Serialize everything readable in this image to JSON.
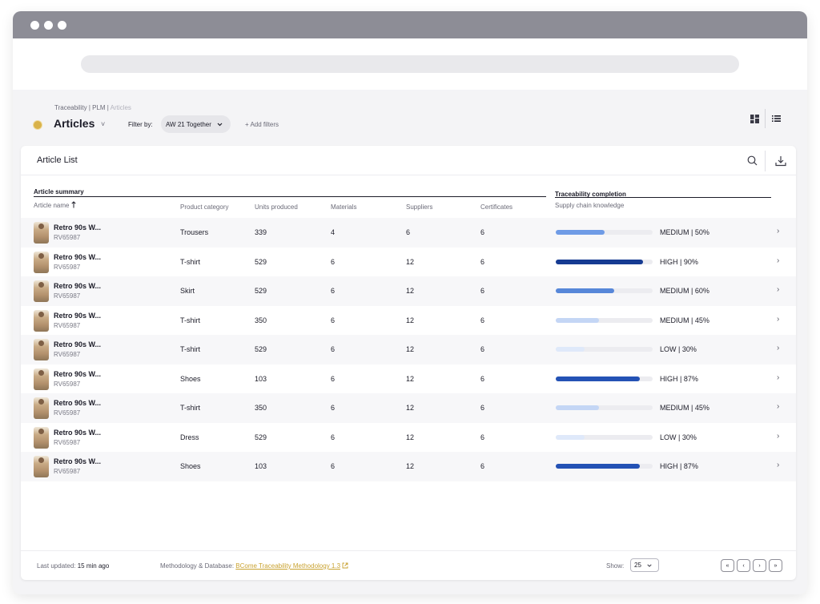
{
  "window": {
    "colors": {
      "titlebar": "#8d8d96",
      "accent": "#d9b24a",
      "link": "#c9a230"
    }
  },
  "header": {
    "breadcrumb": {
      "part1": "Traceability | PLM | ",
      "current": "Articles"
    },
    "title": "Articles",
    "title_chevron": "˅",
    "filter_label": "Filter by:",
    "filter_value": "AW 21 Together",
    "add_filters": "+ Add filters"
  },
  "card": {
    "title": "Article List",
    "groups": {
      "summary": "Article summary",
      "traceability": "Traceability completion"
    },
    "columns": {
      "name": "Article name",
      "category": "Product category",
      "units": "Units produced",
      "materials": "Materials",
      "suppliers": "Suppliers",
      "certificates": "Certificates",
      "knowledge": "Supply chain knowledge"
    },
    "rows": [
      {
        "name": "Retro 90s W...",
        "code": "RV65987",
        "category": "Trousers",
        "units": "339",
        "materials": "4",
        "suppliers": "6",
        "certificates": "6",
        "status": "MEDIUM | 50%",
        "progress": 0.5,
        "color": "#6f9be6"
      },
      {
        "name": "Retro 90s W...",
        "code": "RV65987",
        "category": "T-shirt",
        "units": "529",
        "materials": "6",
        "suppliers": "12",
        "certificates": "6",
        "status": "HIGH | 90%",
        "progress": 0.9,
        "color": "#163b92"
      },
      {
        "name": "Retro 90s W...",
        "code": "RV65987",
        "category": "Skirt",
        "units": "529",
        "materials": "6",
        "suppliers": "12",
        "certificates": "6",
        "status": "MEDIUM | 60%",
        "progress": 0.6,
        "color": "#5787d9"
      },
      {
        "name": "Retro 90s W...",
        "code": "RV65987",
        "category": "T-shirt",
        "units": "350",
        "materials": "6",
        "suppliers": "12",
        "certificates": "6",
        "status": "MEDIUM | 45%",
        "progress": 0.45,
        "color": "#c4d6f5"
      },
      {
        "name": "Retro 90s W...",
        "code": "RV65987",
        "category": "T-shirt",
        "units": "529",
        "materials": "6",
        "suppliers": "12",
        "certificates": "6",
        "status": "LOW | 30%",
        "progress": 0.3,
        "color": "#dfe9fa"
      },
      {
        "name": "Retro 90s W...",
        "code": "RV65987",
        "category": "Shoes",
        "units": "103",
        "materials": "6",
        "suppliers": "12",
        "certificates": "6",
        "status": "HIGH | 87%",
        "progress": 0.87,
        "color": "#2452b5"
      },
      {
        "name": "Retro 90s W...",
        "code": "RV65987",
        "category": "T-shirt",
        "units": "350",
        "materials": "6",
        "suppliers": "12",
        "certificates": "6",
        "status": "MEDIUM | 45%",
        "progress": 0.45,
        "color": "#c4d6f5"
      },
      {
        "name": "Retro 90s W...",
        "code": "RV65987",
        "category": "Dress",
        "units": "529",
        "materials": "6",
        "suppliers": "12",
        "certificates": "6",
        "status": "LOW | 30%",
        "progress": 0.3,
        "color": "#dfe9fa"
      },
      {
        "name": "Retro 90s W...",
        "code": "RV65987",
        "category": "Shoes",
        "units": "103",
        "materials": "6",
        "suppliers": "12",
        "certificates": "6",
        "status": "HIGH | 87%",
        "progress": 0.87,
        "color": "#2452b5"
      }
    ]
  },
  "footer": {
    "updated_label": "Last updated:",
    "updated_value": "15 min ago",
    "method_label": "Methodology & Database:",
    "method_link": "BCome Traceability Methodology 1.3",
    "show_label": "Show:",
    "show_value": "25",
    "pager": {
      "first": "«",
      "prev": "‹",
      "next": "›",
      "last": "»"
    }
  }
}
